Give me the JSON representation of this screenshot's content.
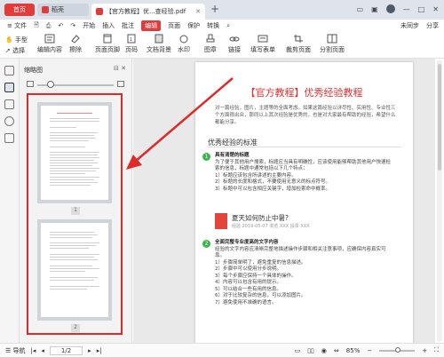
{
  "tabs": {
    "home": "首页",
    "daoke": "稻壳",
    "pdf": "【官方教程】优...查经验.pdf"
  },
  "menubar": {
    "file": "≡ 文件",
    "items": [
      "开始",
      "插入",
      "批注",
      "编辑",
      "页面",
      "保护",
      "转换"
    ],
    "active": "编辑",
    "right": [
      "未同步",
      "分享"
    ]
  },
  "toolbar": {
    "hand": "手型",
    "select": "选择",
    "tools": [
      "编辑内容",
      "擦除",
      "页面页脚",
      "页码",
      "文档背景",
      "水印",
      "图章",
      "链接",
      "填写表单",
      "裁剪页面",
      "分割页面"
    ]
  },
  "thumbpanel": {
    "title": "缩略图",
    "page1": "1",
    "page2": "2"
  },
  "doc": {
    "title": "【官方教程】优秀经验教程",
    "intro": "对一篇经验，图片，主题等的全面考虑。如果这篇经验以详尽性、实用性、专业性三个方面很出众，那同以上其次经验是优秀的，也是对大家最有帮助的经验，希望什么都能分享。",
    "section": "优秀经验的标准",
    "step1_title": "具有清楚的标题",
    "step1_body": "为了便于其他用户搜索，标题应当具有明确性，应该使用能够帮助其他用户快速检索的信息，标题中通常包括以下几个特点：",
    "step1_points": [
      "1）标题应该包含所讲述的主要内容。",
      "2）标题的长度和格式，不要使用无意义的标点符号。",
      "3）标题中可以包含相应关键字，增加检索命中概率。"
    ],
    "card_title": "夏天如何防止中暑?",
    "card_meta": "经验 2019-05-07 浏览 XXX 投票 XXX",
    "step2_title": "全面完整专业度高的文字内容",
    "step2_body": "经验的文字内容应清晰完整地描述操作步骤和相关注意事项，应确保内容真实可靠。",
    "step2_points": [
      "1）步骤简单明了，避免重复的信息描述。",
      "2）步骤中可以使用分步说明。",
      "3）每个步骤应保持一个具体的操作。",
      "4）内容可以包含有用的提示。",
      "5）可以结合一些有用的信息。",
      "6）对于比较复杂的信息，可以添加图片。",
      "7）避免使用不准确的语言。"
    ]
  },
  "status": {
    "nav": "导航",
    "page": "1/2",
    "zoom": "85%"
  },
  "colors": {
    "accent": "#e23b3b",
    "highlight_box": "#e02a2a",
    "step_green": "#3cb44b"
  }
}
